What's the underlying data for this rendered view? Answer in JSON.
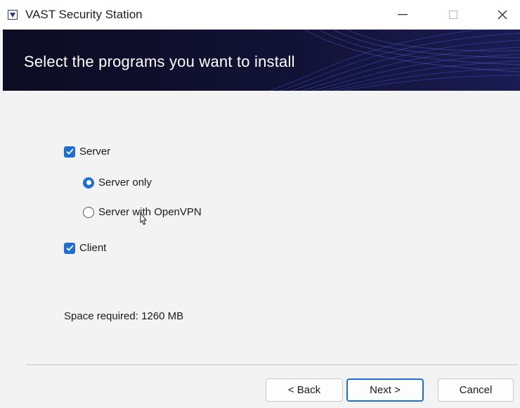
{
  "window": {
    "title": "VAST Security Station",
    "minimize_glyph": "—",
    "maximize_glyph": "☐",
    "close_glyph": "✕"
  },
  "header": {
    "title": "Select the programs you want to install"
  },
  "options": {
    "server": {
      "label": "Server",
      "checked": true
    },
    "server_only": {
      "label": "Server only",
      "selected": true
    },
    "server_openvpn": {
      "label": "Server with OpenVPN",
      "selected": false
    },
    "client": {
      "label": "Client",
      "checked": true
    }
  },
  "space": {
    "text": "Space required: 1260 MB"
  },
  "buttons": {
    "back": "< Back",
    "next": "Next >",
    "cancel": "Cancel"
  },
  "colors": {
    "accent": "#1f6fd1",
    "banner": "#0d0d24"
  }
}
